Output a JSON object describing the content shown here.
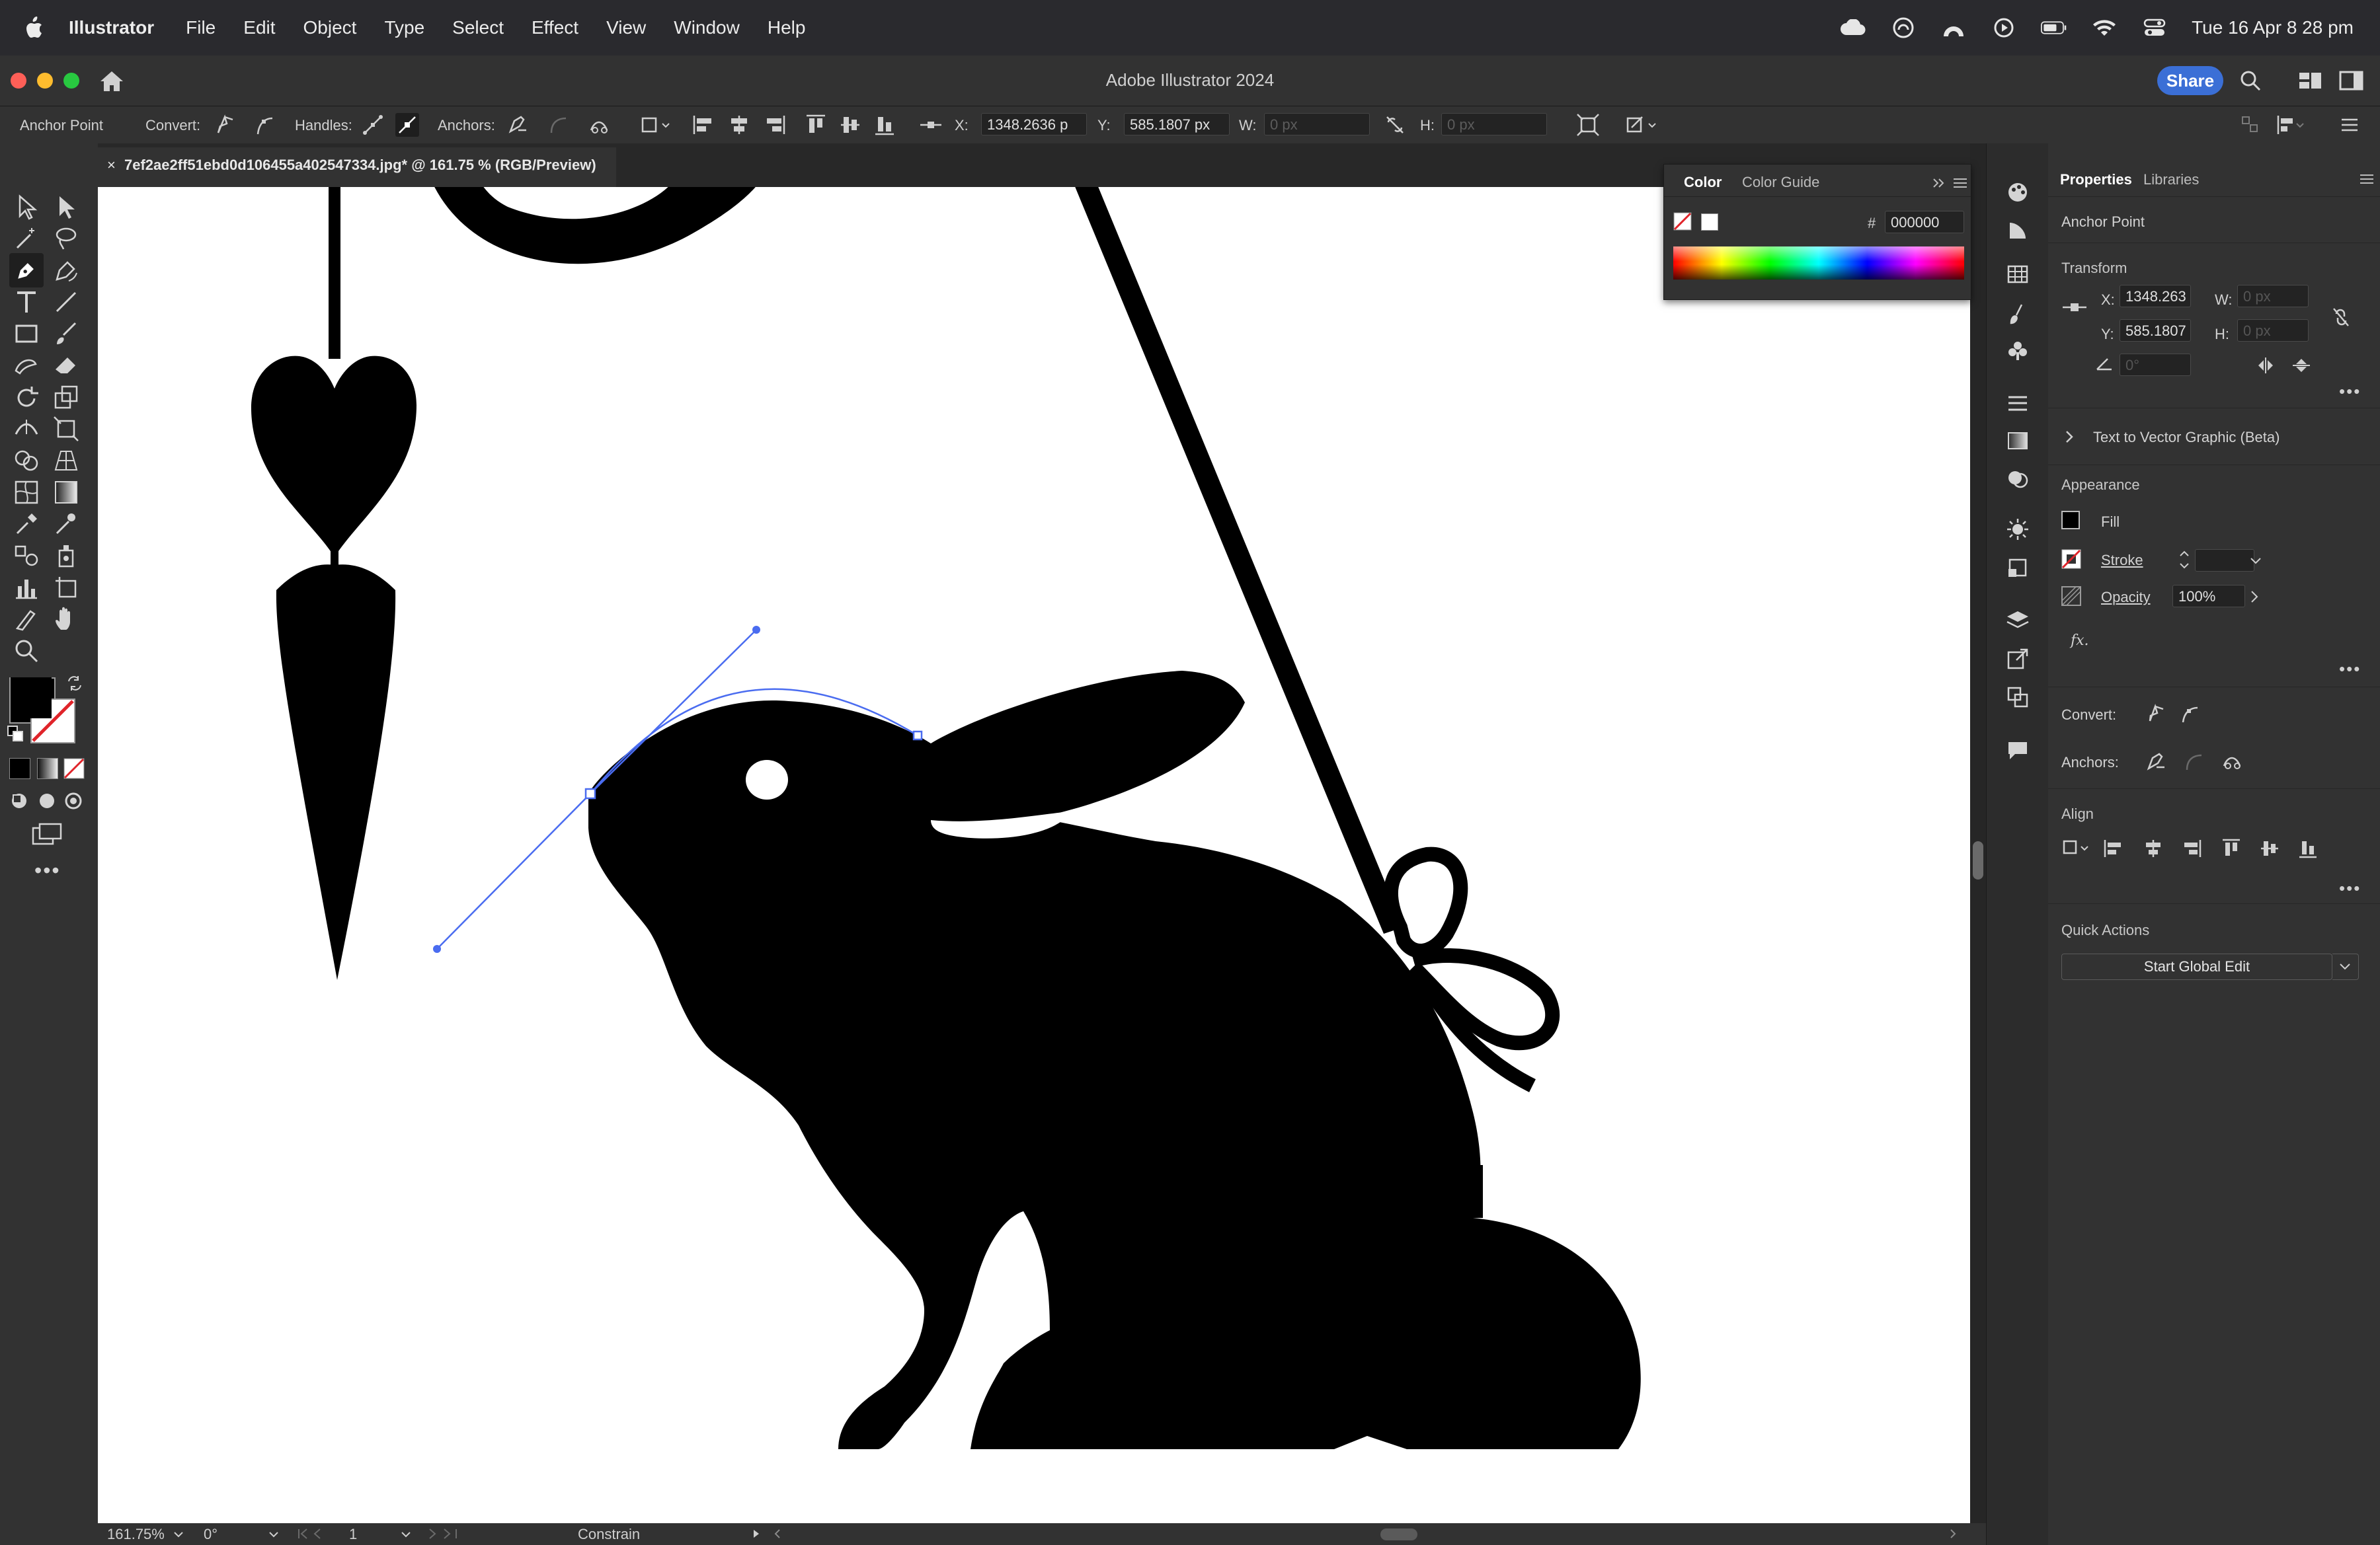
{
  "menubar": {
    "app_name": "Illustrator",
    "items": [
      "File",
      "Edit",
      "Object",
      "Type",
      "Select",
      "Effect",
      "View",
      "Window",
      "Help"
    ],
    "clock": "Tue 16 Apr  8 28 pm"
  },
  "titlebar": {
    "title": "Adobe Illustrator 2024",
    "share_label": "Share"
  },
  "controlbar": {
    "mode_label": "Anchor Point",
    "convert_label": "Convert:",
    "handles_label": "Handles:",
    "anchors_label": "Anchors:",
    "x_label": "X:",
    "x_value": "1348.2636 p",
    "y_label": "Y:",
    "y_value": "585.1807 px",
    "w_label": "W:",
    "w_value": "0 px",
    "h_label": "H:",
    "h_value": "0 px"
  },
  "document_tab": {
    "close": "×",
    "title": "7ef2ae2ff51ebd0d106455a402547334.jpg* @ 161.75 % (RGB/Preview)"
  },
  "color_panel": {
    "tab_active": "Color",
    "tab_other": "Color Guide",
    "hash_label": "#",
    "hex_value": "000000"
  },
  "properties": {
    "tab_active": "Properties",
    "tab_other": "Libraries",
    "selection_type": "Anchor Point",
    "transform_heading": "Transform",
    "x_label": "X:",
    "x_value": "1348.263",
    "y_label": "Y:",
    "y_value": "585.1807",
    "w_label": "W:",
    "w_value": "0 px",
    "h_label": "H:",
    "h_value": "0 px",
    "angle_value": "0°",
    "text_to_vector": "Text to Vector Graphic (Beta)",
    "appearance_heading": "Appearance",
    "fill_label": "Fill",
    "stroke_label": "Stroke",
    "opacity_label": "Opacity",
    "opacity_value": "100%",
    "fx_label": "fx.",
    "convert_label": "Convert:",
    "anchors_label": "Anchors:",
    "align_heading": "Align",
    "quick_actions_heading": "Quick Actions",
    "global_edit_label": "Start Global Edit"
  },
  "statusbar": {
    "zoom": "161.75%",
    "rotation": "0°",
    "artboard": "1",
    "constrain": "Constrain"
  },
  "colors": {
    "accent": "#3b6fd6",
    "path_selection": "#4a6cf0",
    "artwork": "#000000"
  }
}
